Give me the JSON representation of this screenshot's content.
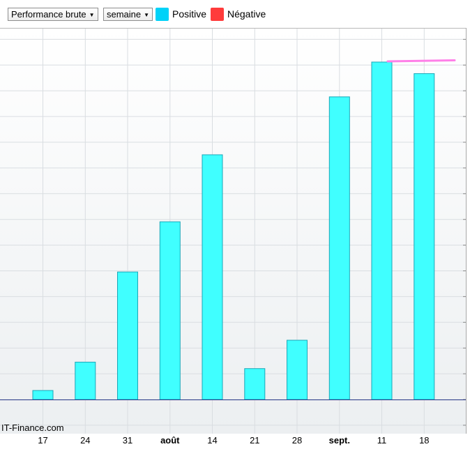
{
  "toolbar": {
    "metric_select": "Performance brute",
    "period_select": "semaine"
  },
  "legend": [
    {
      "label": "Positive",
      "color": "#00d8ff"
    },
    {
      "label": "Négative",
      "color": "#ff3b3b"
    }
  ],
  "watermark": "IT-Finance.com",
  "colors": {
    "bar_fill": "#40ffff",
    "bar_stroke": "#1aa7b8",
    "zero_line": "#2b3a8a",
    "annotation": "#ff80e8"
  },
  "chart_data": {
    "type": "bar",
    "categories": [
      "17",
      "24",
      "31",
      "août",
      "14",
      "21",
      "28",
      "sept.",
      "11",
      "18"
    ],
    "bold_categories": [
      "août",
      "sept."
    ],
    "values": [
      0.35,
      1.45,
      4.95,
      6.9,
      9.5,
      1.2,
      2.3,
      11.75,
      13.1,
      12.65
    ],
    "ylim": [
      -1,
      14.5
    ],
    "grid": true,
    "y_tick_labels_visible": false,
    "title": "",
    "xlabel": "",
    "ylabel": ""
  }
}
